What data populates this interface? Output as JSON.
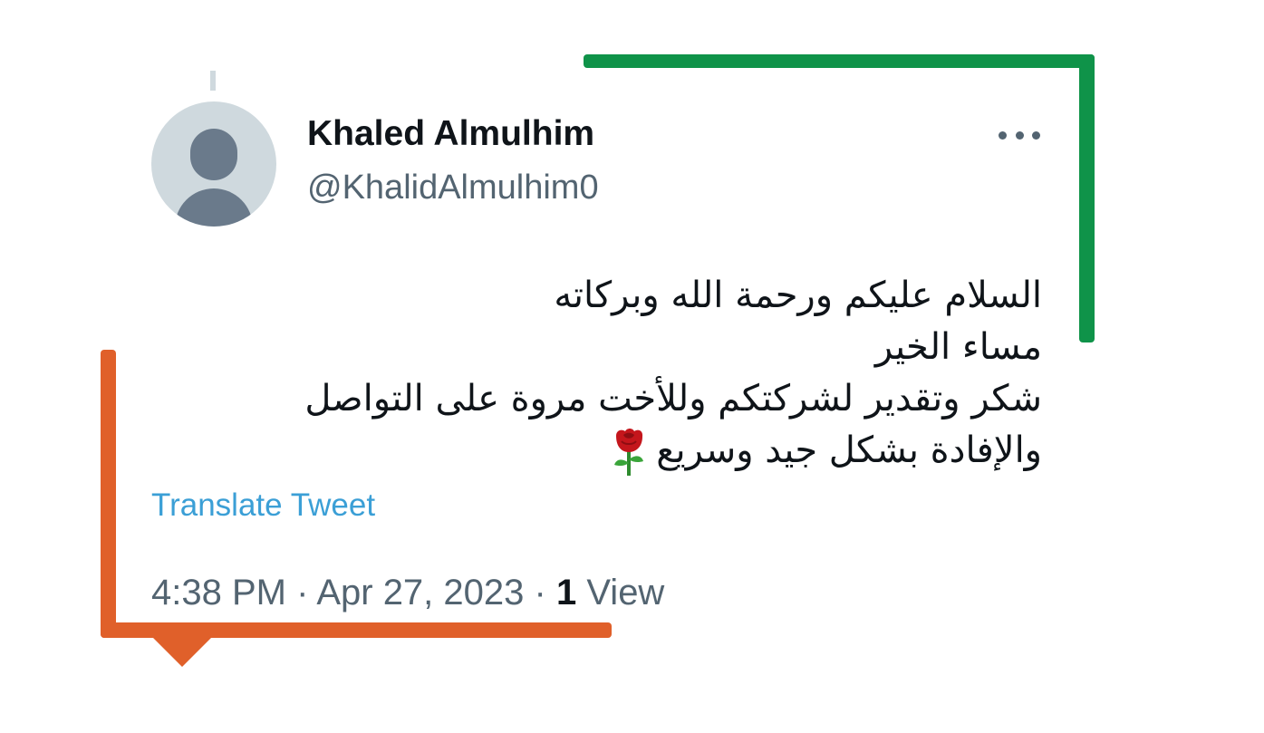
{
  "tweet": {
    "author": {
      "display_name": "Khaled Almulhim",
      "handle": "@KhalidAlmulhim0",
      "avatar": "default-avatar-icon"
    },
    "more_icon": "more-options-icon",
    "text_lines": [
      "السلام عليكم ورحمة الله وبركاته",
      "مساء الخير",
      "شكر وتقدير لشركتكم وللأخت مروة على التواصل",
      "والإفادة بشكل جيد وسريع"
    ],
    "emoji": "rose-icon",
    "translate_label": "Translate Tweet",
    "time": "4:38 PM",
    "separator": "·",
    "date": "Apr 27, 2023",
    "views_count": "1",
    "views_label": "View"
  },
  "colors": {
    "green_frame": "#0f9349",
    "orange_frame": "#e0602a",
    "link": "#3b9fd6",
    "secondary_text": "#536471",
    "primary_text": "#0f1419"
  }
}
